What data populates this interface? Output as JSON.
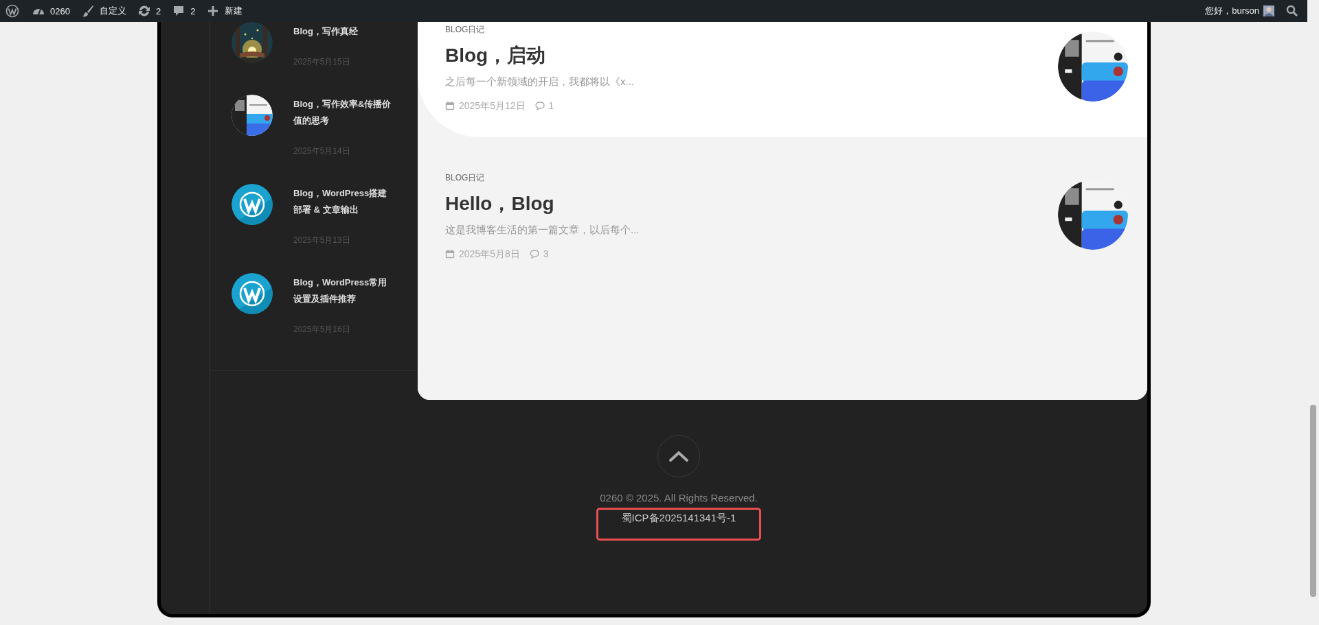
{
  "admin_bar": {
    "site": "0260",
    "customize": "自定义",
    "updates": "2",
    "comments": "2",
    "new": "新建",
    "greeting": "您好，burson"
  },
  "sidebar_posts": [
    {
      "title": "Blog，写作真经",
      "date": "2025年5月15日"
    },
    {
      "title": "Blog，写作效率&传播价值的思考",
      "date": "2025年5月14日",
      "kind": "screenshot"
    },
    {
      "title": "Blog，WordPress搭建部署 & 文章输出",
      "date": "2025年5月13日",
      "kind": "logo"
    },
    {
      "title": "Blog，WordPress常用设置及插件推荐",
      "date": "2025年5月16日",
      "kind": "logo"
    }
  ],
  "posts": [
    {
      "category": "BLOG日记",
      "title": "Blog，启动",
      "excerpt": "之后每一个新领域的开启，我都将以《x...",
      "date": "2025年5月12日",
      "comments": "1"
    },
    {
      "category": "BLOG日记",
      "title": "Hello，Blog",
      "excerpt": "这是我博客生活的第一篇文章，以后每个...",
      "date": "2025年5月8日",
      "comments": "3"
    }
  ],
  "footer": {
    "copyright": "0260 © 2025. All Rights Reserved.",
    "icp": "蜀ICP备2025141341号-1"
  }
}
